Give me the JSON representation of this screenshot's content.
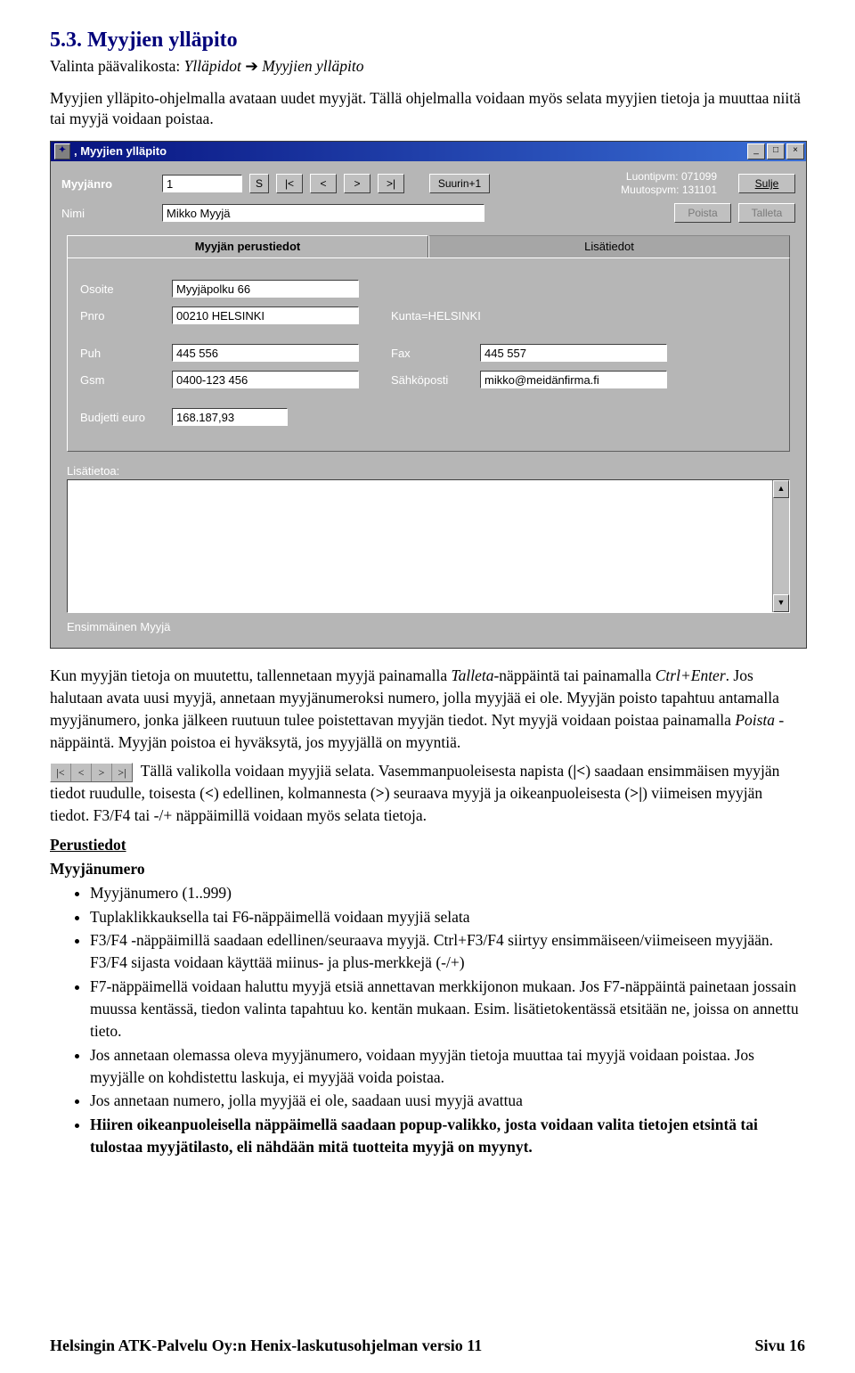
{
  "heading": "5.3. Myyjien ylläpito",
  "intro_prefix": "Valinta päävalikosta: ",
  "intro_i1": "Ylläpidot",
  "intro_arrow": "➔",
  "intro_i2": "Myyjien ylläpito",
  "intro2": "Myyjien ylläpito-ohjelmalla avataan uudet myyjät. Tällä ohjelmalla voidaan myös selata myyjien tietoja ja muuttaa niitä tai myyjä voidaan poistaa.",
  "win": {
    "title": ", Myyjien ylläpito",
    "min": "_",
    "max": "□",
    "close": "×",
    "lbl_nro": "Myyjänro",
    "nro": "1",
    "s": "S",
    "nav_first": "|<",
    "nav_prev": "<",
    "nav_next": ">",
    "nav_last": ">|",
    "btn_suurin": "Suurin+1",
    "luo": "Luontipvm: 071099",
    "muu": "Muutospvm: 131101",
    "btn_sulje": "Sulje",
    "btn_poista": "Poista",
    "btn_talleta": "Talleta",
    "lbl_nimi": "Nimi",
    "nimi": "Mikko Myyjä",
    "tab1": "Myyjän perustiedot",
    "tab2": "Lisätiedot",
    "lbl_osoite": "Osoite",
    "osoite": "Myyjäpolku 66",
    "lbl_pnro": "Pnro",
    "pnro": "00210 HELSINKI",
    "kunta": "Kunta=HELSINKI",
    "lbl_puh": "Puh",
    "puh": "445 556",
    "lbl_fax": "Fax",
    "fax": "445 557",
    "lbl_gsm": "Gsm",
    "gsm": "0400-123 456",
    "lbl_email": "Sähköposti",
    "email": "mikko@meidänfirma.fi",
    "lbl_bud": "Budjetti euro",
    "bud": "168.187,93",
    "lbl_lisa": "Lisätietoa:",
    "status": "Ensimmäinen Myyjä"
  },
  "para1_a": "Kun myyjän tietoja on muutettu, tallennetaan myyjä painamalla ",
  "para1_b": "Talleta",
  "para1_c": "-näppäintä tai painamalla ",
  "para1_d": "Ctrl+Enter",
  "para1_e": ". Jos halutaan avata uusi myyjä, annetaan myyjänumeroksi numero, jolla myyjää ei ole. Myyjän poisto tapahtuu antamalla myyjänumero, jonka jälkeen ruutuun tulee poistettavan myyjän tiedot. Nyt myyjä voidaan poistaa painamalla ",
  "para1_f": "Poista",
  "para1_g": " -näppäintä. Myyjän poistoa ei hyväksytä, jos myyjällä on myyntiä.",
  "para2_a": "Tällä valikolla voidaan myyjiä selata. Vasemmanpuoleisesta napista (",
  "para2_b": ") saadaan ensimmäisen myyjän tiedot ruudulle, toisesta (",
  "para2_c": ") edellinen, kolmannesta (",
  "para2_d": ") seuraava myyjä ja oikeanpuoleisesta (",
  "para2_e": ") viimeisen myyjän tiedot. F3/F4 tai -/+ näppäimillä voidaan myös selata tietoja.",
  "sym1": "|<",
  "sym2": "<",
  "sym3": ">",
  "sym4": ">|",
  "sub1": "Perustiedot",
  "sub2": "Myyjänumero",
  "li1": "Myyjänumero (1..999)",
  "li2": "Tuplaklikkauksella tai F6-näppäimellä voidaan myyjiä selata",
  "li3": "F3/F4 -näppäimillä saadaan edellinen/seuraava myyjä. Ctrl+F3/F4 siirtyy ensimmäiseen/viimeiseen myyjään. F3/F4 sijasta voidaan käyttää miinus- ja plus-merkkejä (-/+)",
  "li4": "F7-näppäimellä voidaan haluttu myyjä etsiä annettavan merkkijonon mukaan. Jos F7-näppäintä painetaan jossain muussa kentässä, tiedon valinta tapahtuu ko. kentän mukaan. Esim. lisätietokentässä etsitään ne, joissa on annettu tieto.",
  "li5": "Jos annetaan olemassa oleva myyjänumero, voidaan myyjän tietoja muuttaa tai myyjä voidaan poistaa. Jos myyjälle on kohdistettu laskuja, ei myyjää voida poistaa.",
  "li6": "Jos annetaan numero, jolla myyjää ei ole, saadaan uusi myyjä avattua",
  "li7": "Hiiren oikeanpuoleisella näppäimellä saadaan popup-valikko, josta voidaan valita tietojen etsintä tai tulostaa myyjätilasto, eli nähdään mitä tuotteita myyjä on myynyt.",
  "footer_l": "Helsingin ATK-Palvelu Oy:n Henix-laskutusohjelman versio 11",
  "footer_r": "Sivu 16"
}
